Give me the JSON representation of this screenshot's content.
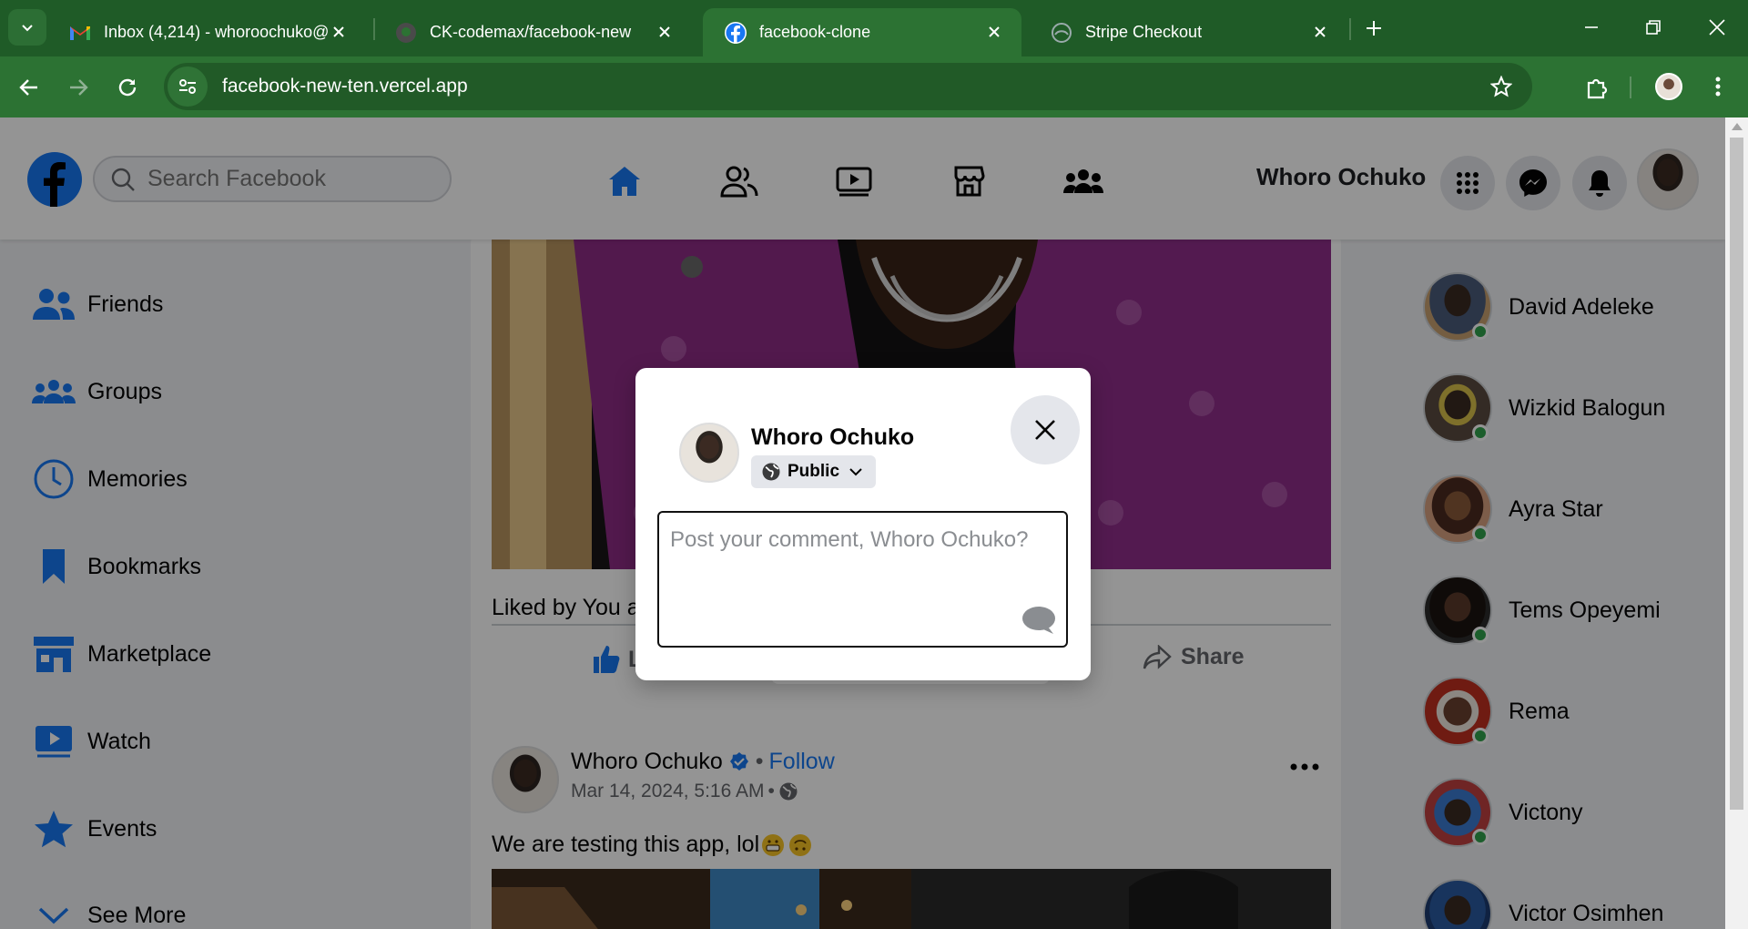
{
  "browser": {
    "tabs": [
      {
        "title": "Inbox (4,214) - whoroochuko@",
        "icon": "gmail-icon"
      },
      {
        "title": "CK-codemax/facebook-new",
        "icon": "github-icon"
      },
      {
        "title": "facebook-clone",
        "icon": "facebook-icon"
      },
      {
        "title": "Stripe Checkout",
        "icon": "globe-icon"
      }
    ],
    "url": "facebook-new-ten.vercel.app",
    "colors": {
      "frame": "#1f5b27",
      "toolbar": "#2c7233"
    }
  },
  "header": {
    "search_placeholder": "Search Facebook",
    "username": "Whoro Ochuko",
    "nav": [
      "home-icon",
      "friends-icon",
      "watch-icon",
      "marketplace-icon",
      "groups-icon"
    ],
    "accent": "#1877f2"
  },
  "sidebar": {
    "items": [
      {
        "label": "Friends",
        "icon": "friends-icon"
      },
      {
        "label": "Groups",
        "icon": "groups-icon"
      },
      {
        "label": "Memories",
        "icon": "clock-icon"
      },
      {
        "label": "Bookmarks",
        "icon": "bookmark-icon"
      },
      {
        "label": "Marketplace",
        "icon": "store-icon"
      },
      {
        "label": "Watch",
        "icon": "watch-icon"
      },
      {
        "label": "Events",
        "icon": "star-icon"
      },
      {
        "label": "See More",
        "icon": "chevron-down-icon"
      }
    ]
  },
  "feed": {
    "post1": {
      "liked_by": "Liked by You a",
      "like_label": "L",
      "share_label": "Share"
    },
    "post2": {
      "author": "Whoro Ochuko",
      "follow": "Follow",
      "separator": "•",
      "timestamp": "Mar 14, 2024, 5:16 AM",
      "text": "We are testing this app, lol"
    }
  },
  "contacts": [
    {
      "name": "David Adeleke"
    },
    {
      "name": "Wizkid Balogun"
    },
    {
      "name": "Ayra Star"
    },
    {
      "name": "Tems Opeyemi"
    },
    {
      "name": "Rema"
    },
    {
      "name": "Victony"
    },
    {
      "name": "Victor Osimhen"
    }
  ],
  "modal": {
    "name": "Whoro Ochuko",
    "privacy": "Public",
    "comment_placeholder": "Post your comment, Whoro Ochuko?",
    "comment_value": ""
  }
}
